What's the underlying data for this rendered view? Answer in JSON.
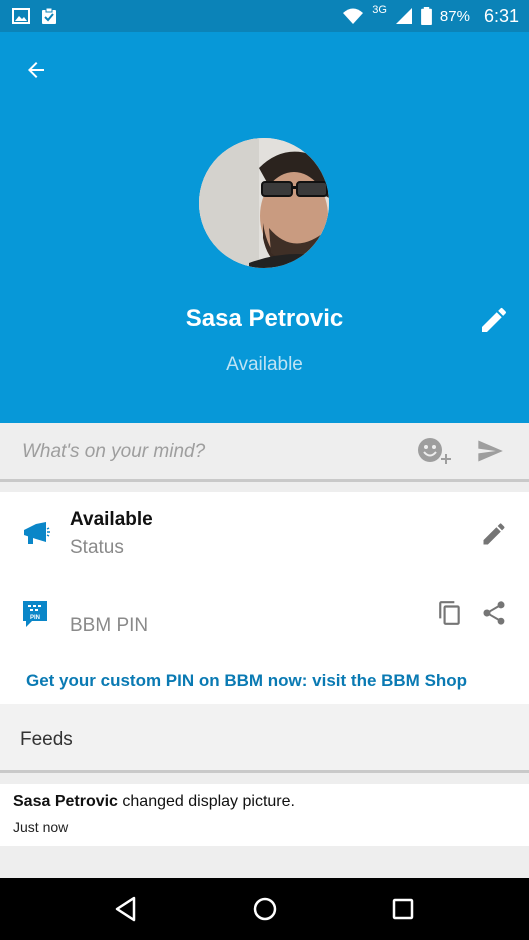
{
  "status_bar": {
    "network": "3G",
    "battery_percent": "87%",
    "time": "6:31",
    "left_icons": [
      "gallery-icon",
      "clipboard-check-icon"
    ],
    "right_icons": [
      "wifi-icon",
      "signal-icon",
      "battery-icon"
    ]
  },
  "header": {
    "name": "Sasa Petrovic",
    "status": "Available",
    "background_color": "#0798d8",
    "icons": [
      "back-arrow-icon",
      "pencil-icon"
    ]
  },
  "composer": {
    "placeholder": "What's on your mind?",
    "icons": [
      "add-emoji-icon",
      "send-icon"
    ]
  },
  "info": {
    "status_value": "Available",
    "status_caption": "Status",
    "pin_label": "BBM PIN",
    "shop_link": "Get your custom PIN on BBM now: visit the BBM Shop",
    "link_color": "#0a7ab3",
    "icons": [
      "megaphone-icon",
      "bbm-pin-icon",
      "pencil-icon",
      "copy-icon",
      "share-icon"
    ]
  },
  "feeds": {
    "title": "Feeds",
    "items": [
      {
        "author": "Sasa Petrovic",
        "action": " changed display picture.",
        "time": "Just now"
      }
    ]
  },
  "nav": {
    "icons": [
      "back-triangle-icon",
      "home-circle-icon",
      "recents-square-icon"
    ]
  }
}
